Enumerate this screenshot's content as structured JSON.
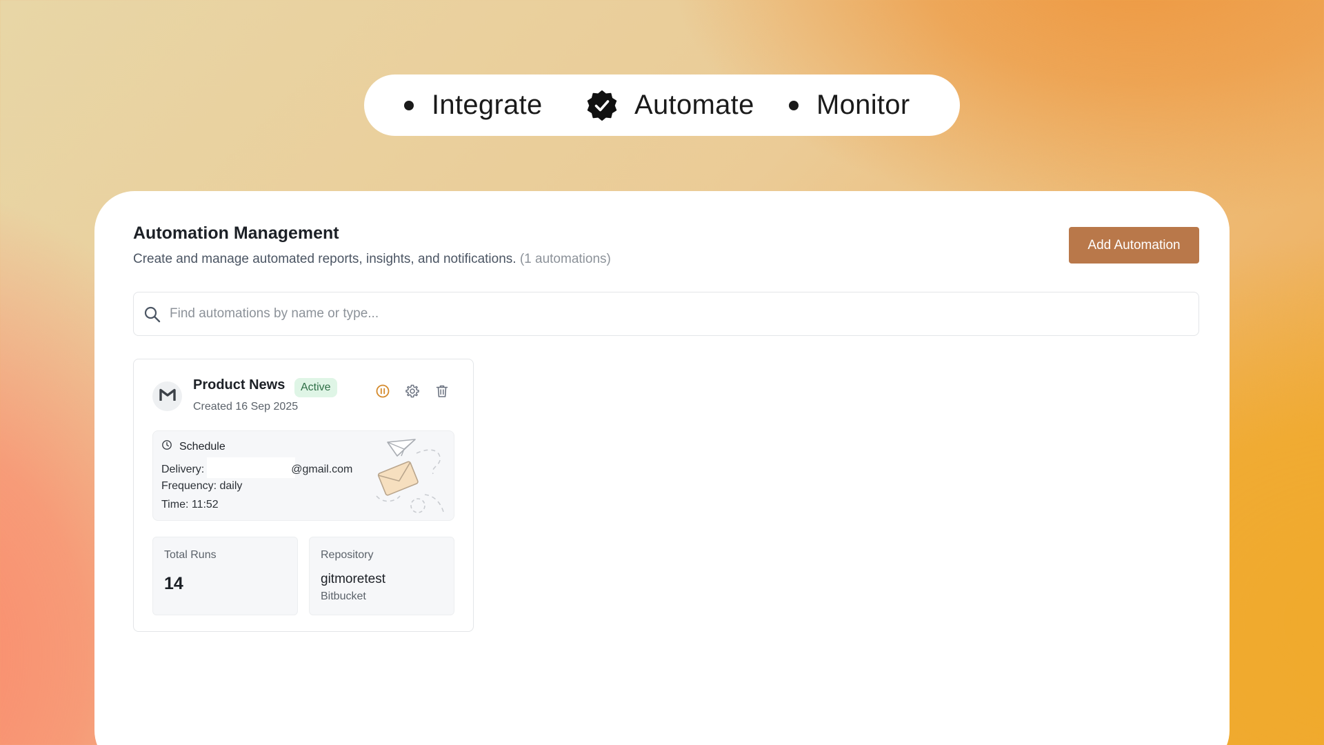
{
  "steps": [
    {
      "label": "Integrate",
      "state": "pending"
    },
    {
      "label": "Automate",
      "state": "current"
    },
    {
      "label": "Monitor",
      "state": "pending"
    }
  ],
  "header": {
    "title": "Automation Management",
    "subtitle": "Create and manage automated reports, insights, and notifications.",
    "count_text": "(1 automations)",
    "add_label": "Add Automation"
  },
  "search": {
    "placeholder": "Find automations by name or type...",
    "value": ""
  },
  "automations": [
    {
      "avatar_icon": "gmail-icon",
      "name": "Product News",
      "status": "Active",
      "created": "Created 16 Sep 2025",
      "schedule": {
        "title": "Schedule",
        "delivery_label": "Delivery:",
        "delivery_value": "@gmail.com",
        "frequency": "Frequency: daily",
        "time": "Time: 11:52"
      },
      "stats": {
        "runs_label": "Total Runs",
        "runs_value": "14",
        "repo_label": "Repository",
        "repo_name": "gitmoretest",
        "repo_provider": "Bitbucket"
      }
    }
  ],
  "colors": {
    "accent": "#b9784a",
    "pause_icon": "#d4892a",
    "active_badge_bg": "#dff5e6",
    "active_badge_text": "#2d6e45"
  }
}
